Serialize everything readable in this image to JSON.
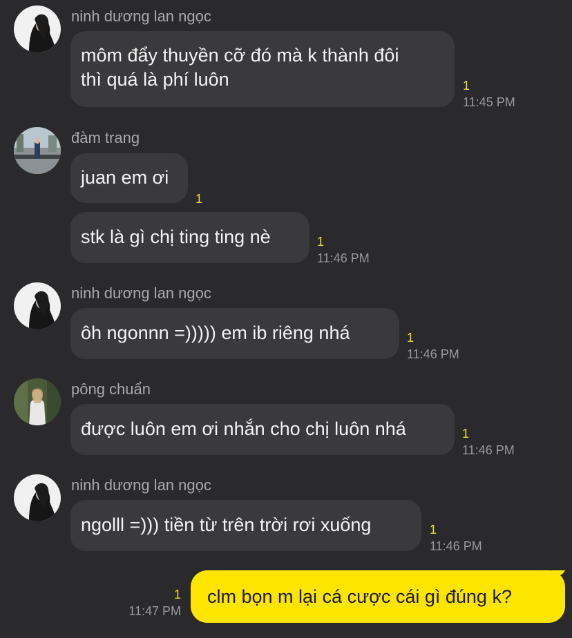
{
  "colors": {
    "background": "#2a2a2c",
    "received_bubble": "#3a3a3c",
    "sent_bubble": "#fee500",
    "unread_count": "#f2dc3a",
    "timestamp": "#9a9a9c",
    "sender_name": "#a9a9ab"
  },
  "messages": [
    {
      "sender": "ninh dương lan ngọc",
      "avatar": "avatar-lan-ngoc",
      "bubbles": [
        {
          "lines": [
            "môm đẩy thuyền cỡ đó mà k thành đôi",
            "thì quá là phí luôn"
          ],
          "unread": "1",
          "time": "11:45 PM"
        }
      ]
    },
    {
      "sender": "đàm trang",
      "avatar": "avatar-dam-trang",
      "bubbles": [
        {
          "lines": [
            "juan em ơi"
          ],
          "unread": "1",
          "time": ""
        },
        {
          "lines": [
            "stk là gì chị ting ting nè"
          ],
          "unread": "1",
          "time": "11:46 PM"
        }
      ]
    },
    {
      "sender": "ninh dương lan ngọc",
      "avatar": "avatar-lan-ngoc",
      "bubbles": [
        {
          "lines": [
            "ôh ngonnn =))))) em ib riêng nhá"
          ],
          "unread": "1",
          "time": "11:46 PM"
        }
      ]
    },
    {
      "sender": "pông chuẩn",
      "avatar": "avatar-pong-chuan",
      "bubbles": [
        {
          "lines": [
            "được luôn em ơi nhắn cho chị luôn nhá"
          ],
          "unread": "1",
          "time": "11:46 PM"
        }
      ]
    },
    {
      "sender": "ninh dương lan ngọc",
      "avatar": "avatar-lan-ngoc",
      "bubbles": [
        {
          "lines": [
            "ngolll =))) tiền từ trên trời rơi xuống"
          ],
          "unread": "1",
          "time": "11:46 PM"
        }
      ]
    }
  ],
  "my_message": {
    "text": "clm bọn m lại cá cược cái gì đúng k?",
    "unread": "1",
    "time": "11:47 PM"
  }
}
